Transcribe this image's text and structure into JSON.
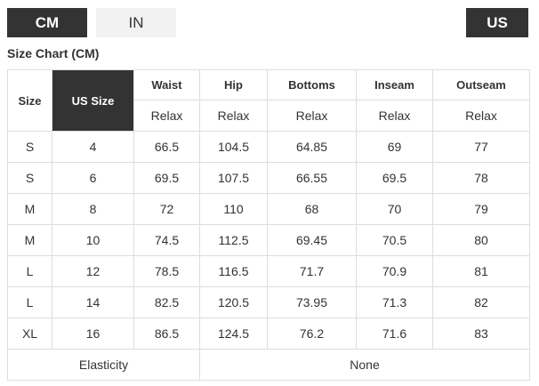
{
  "units": {
    "cm_label": "CM",
    "in_label": "IN",
    "us_label": "US"
  },
  "title": "Size Chart (CM)",
  "table": {
    "headers": {
      "size": "Size",
      "us_size": "US Size",
      "columns": [
        "Waist",
        "Hip",
        "Bottoms",
        "Inseam",
        "Outseam"
      ]
    },
    "fit": [
      "Relax",
      "Relax",
      "Relax",
      "Relax",
      "Relax"
    ],
    "rows": [
      [
        "S",
        "4",
        "66.5",
        "104.5",
        "64.85",
        "69",
        "77"
      ],
      [
        "S",
        "6",
        "69.5",
        "107.5",
        "66.55",
        "69.5",
        "78"
      ],
      [
        "M",
        "8",
        "72",
        "110",
        "68",
        "70",
        "79"
      ],
      [
        "M",
        "10",
        "74.5",
        "112.5",
        "69.45",
        "70.5",
        "80"
      ],
      [
        "L",
        "12",
        "78.5",
        "116.5",
        "71.7",
        "70.9",
        "81"
      ],
      [
        "L",
        "14",
        "82.5",
        "120.5",
        "73.95",
        "71.3",
        "82"
      ],
      [
        "XL",
        "16",
        "86.5",
        "124.5",
        "76.2",
        "71.6",
        "83"
      ]
    ],
    "footer": {
      "label": "Elasticity",
      "value": "None"
    }
  },
  "colors": {
    "active_button": "#333333",
    "inactive_button": "#f2f2f2",
    "border": "#dddddd"
  }
}
